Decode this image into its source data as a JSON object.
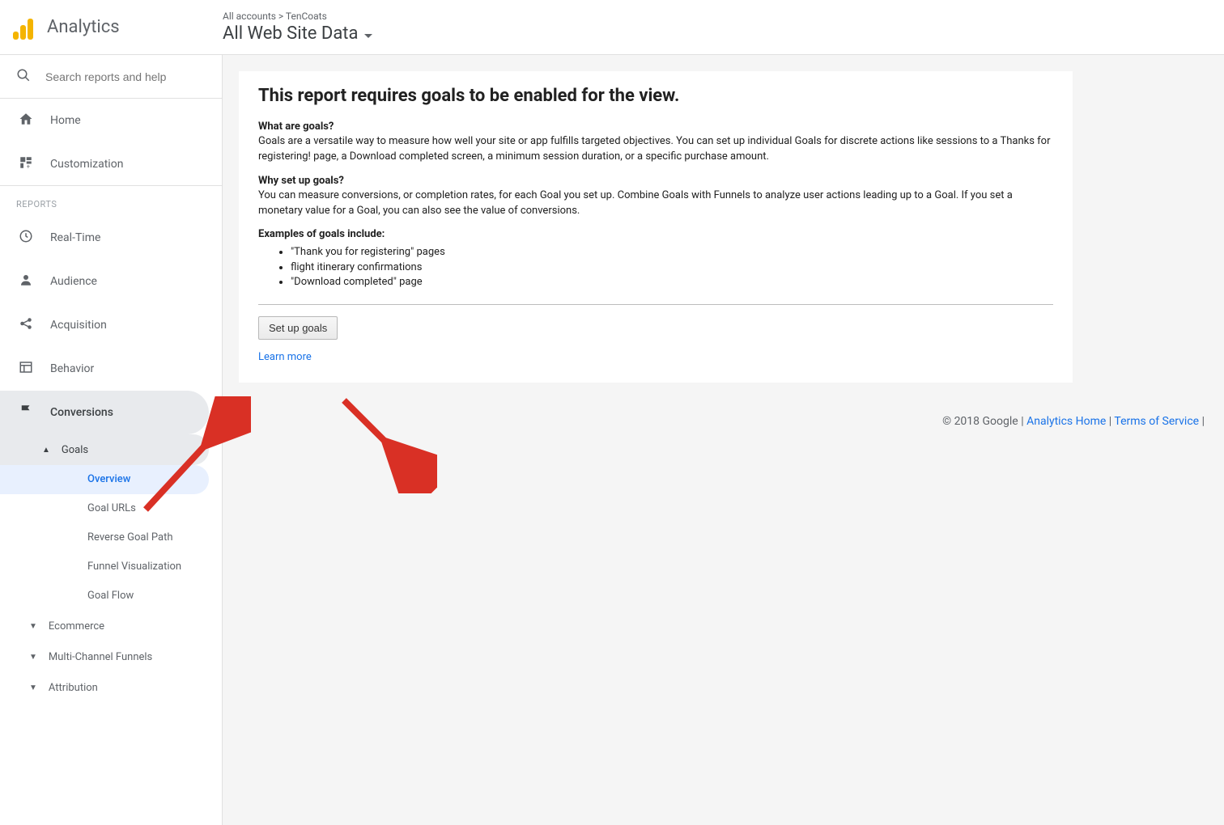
{
  "app": {
    "logo_text": "Analytics",
    "breadcrumb_top": "All accounts > TenCoats",
    "account_label": "All Web Site Data"
  },
  "search": {
    "placeholder": "Search reports and help"
  },
  "nav": {
    "home": "Home",
    "customization": "Customization",
    "reports_label": "REPORTS",
    "realtime": "Real-Time",
    "audience": "Audience",
    "acquisition": "Acquisition",
    "behavior": "Behavior",
    "conversions": "Conversions",
    "goals": "Goals",
    "goals_children": {
      "overview": "Overview",
      "goal_urls": "Goal URLs",
      "reverse_goal_path": "Reverse Goal Path",
      "funnel_visualization": "Funnel Visualization",
      "goal_flow": "Goal Flow"
    },
    "ecommerce": "Ecommerce",
    "multi_channel_funnels": "Multi-Channel Funnels",
    "attribution": "Attribution"
  },
  "content": {
    "title": "This report requires goals to be enabled for the view.",
    "what_heading": "What are goals?",
    "what_body": "Goals are a versatile way to measure how well your site or app fulfills targeted objectives. You can set up individual Goals for discrete actions like sessions to a Thanks for registering! page, a Download completed screen, a minimum session duration, or a specific purchase amount.",
    "why_heading": "Why set up goals?",
    "why_body": "You can measure conversions, or completion rates, for each Goal you set up. Combine Goals with Funnels to analyze user actions leading up to a Goal. If you set a monetary value for a Goal, you can also see the value of conversions.",
    "examples_heading": "Examples of goals include:",
    "examples": [
      "\"Thank you for registering\" pages",
      "flight itinerary confirmations",
      "\"Download completed\" page"
    ],
    "setup_button": "Set up goals",
    "learn_more": "Learn more"
  },
  "footer": {
    "copyright": "© 2018 Google",
    "sep": " | ",
    "analytics_home": "Analytics Home",
    "terms": "Terms of Service"
  }
}
